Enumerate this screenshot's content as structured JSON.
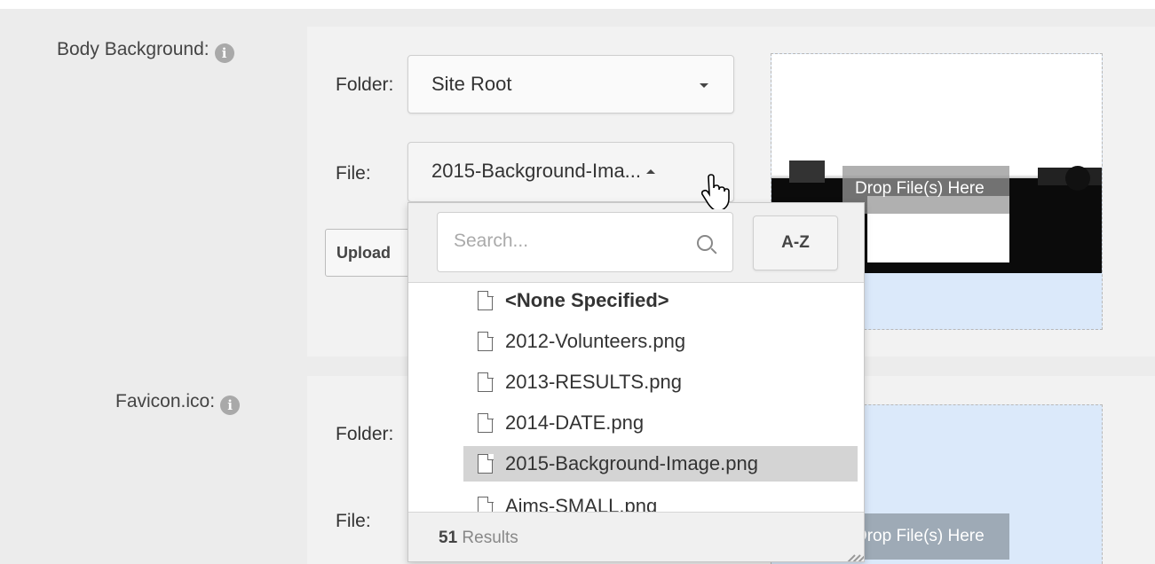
{
  "body_background": {
    "label": "Body Background:",
    "info_icon": "info-icon",
    "folder_label": "Folder:",
    "folder_value": "Site Root",
    "file_label": "File:",
    "file_value": "2015-Background-Ima...",
    "upload_label": "Upload",
    "drop_label": "Drop File(s) Here"
  },
  "favicon": {
    "label": "Favicon.ico:",
    "info_icon": "info-icon",
    "folder_label": "Folder:",
    "file_label": "File:",
    "drop_label": "Drop File(s) Here"
  },
  "dropdown": {
    "search_placeholder": "Search...",
    "sort_label": "A-Z",
    "items": [
      {
        "label": "<None Specified>",
        "bold": true,
        "selected": false
      },
      {
        "label": "2012-Volunteers.png",
        "bold": false,
        "selected": false
      },
      {
        "label": "2013-RESULTS.png",
        "bold": false,
        "selected": false
      },
      {
        "label": "2014-DATE.png",
        "bold": false,
        "selected": false
      },
      {
        "label": "2015-Background-Image.png",
        "bold": false,
        "selected": true
      },
      {
        "label": "Aims-SMALL.png",
        "bold": false,
        "selected": false
      }
    ],
    "results_count": "51",
    "results_label": "Results"
  },
  "colors": {
    "page_bg": "#ececec",
    "panel_bg": "#f2f2f2",
    "drop_bg": "#dbe9fa",
    "selected_item": "#d4d4d4"
  }
}
